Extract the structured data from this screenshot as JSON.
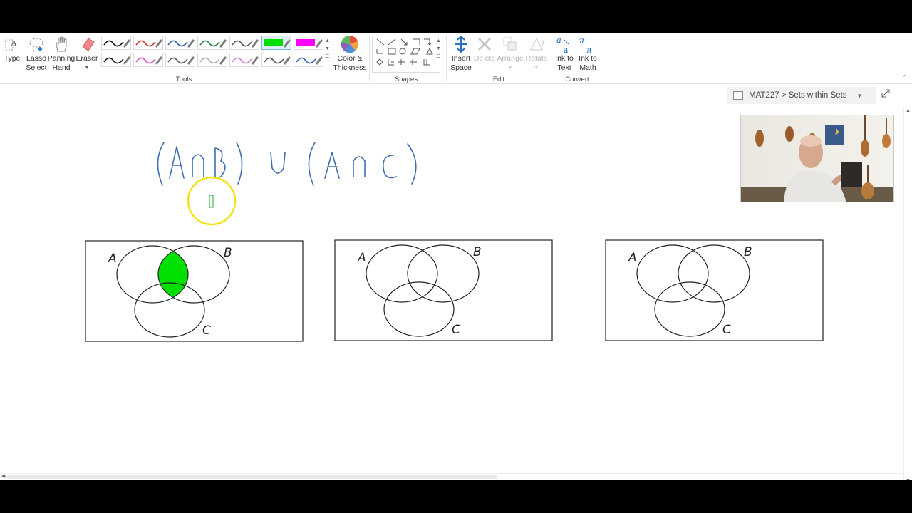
{
  "ribbon": {
    "tools": {
      "type_label": "Type",
      "lasso_label_1": "Lasso",
      "lasso_label_2": "Select",
      "panning_label_1": "Panning",
      "panning_label_2": "Hand",
      "eraser_label": "Eraser",
      "color_label_1": "Color &",
      "color_label_2": "Thickness",
      "group_label": "Tools"
    },
    "shapes": {
      "group_label": "Shapes"
    },
    "edit": {
      "insert_label_1": "Insert",
      "insert_label_2": "Space",
      "delete_label": "Delete",
      "arrange_label": "Arrange",
      "rotate_label": "Rotate",
      "group_label": "Edit"
    },
    "convert": {
      "ink_text_1": "Ink to",
      "ink_text_2": "Text",
      "ink_math_1": "Ink to",
      "ink_math_2": "Math",
      "group_label": "Convert"
    },
    "pens_row1": [
      "#111111",
      "#d03030",
      "#2f5fb0",
      "#1f8040",
      "#555555",
      "#00e000",
      "#ff00ff"
    ],
    "pens_row2": [
      "#111111",
      "#e040c0",
      "#555555",
      "#aaaaaa",
      "#d080d0",
      "#555555",
      "#2f5fb0"
    ]
  },
  "breadcrumb": {
    "text": "MAT227 > Sets within Sets"
  },
  "note": {
    "expression_parts": [
      "(",
      "A",
      "∩",
      "B",
      ")",
      "∪",
      "(",
      "A",
      "∩",
      "C",
      ")"
    ],
    "ink_color": "#3d6fb0",
    "highlight_color": "#00e000",
    "cursor_ring_color": "#f2e31a"
  },
  "venn_diagrams": [
    {
      "labels": {
        "a": "A",
        "b": "B",
        "c": "C"
      },
      "shaded": "A∩B"
    },
    {
      "labels": {
        "a": "A",
        "b": "B",
        "c": "C"
      },
      "shaded": ""
    },
    {
      "labels": {
        "a": "A",
        "b": "B",
        "c": "C"
      },
      "shaded": ""
    }
  ]
}
